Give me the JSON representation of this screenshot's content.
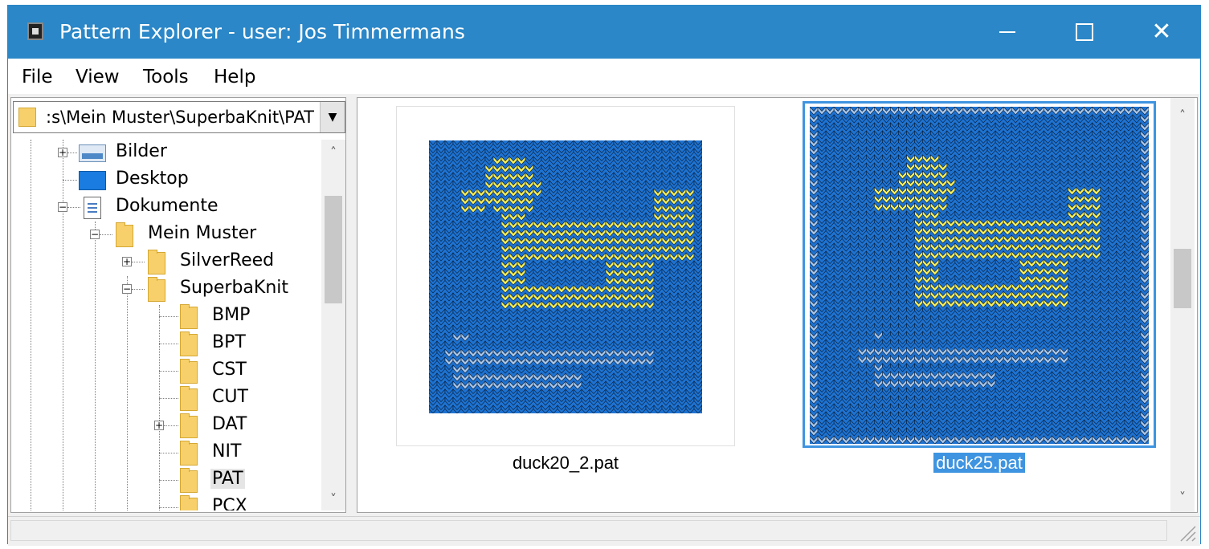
{
  "window": {
    "title": "Pattern Explorer - user: Jos Timmermans",
    "minimize_icon": "minimize-icon",
    "maximize_icon": "maximize-icon",
    "close_icon": "close-icon",
    "close_glyph": "✕"
  },
  "menu": {
    "items": [
      {
        "label": "File"
      },
      {
        "label": "View"
      },
      {
        "label": "Tools"
      },
      {
        "label": "Help"
      }
    ]
  },
  "path_combo": {
    "value": ":s\\Mein Muster\\SuperbaKnit\\PAT",
    "dropdown_glyph": "▼"
  },
  "tree": {
    "items": [
      {
        "label": "Bilder",
        "icon": "pictures-icon",
        "expander": "+"
      },
      {
        "label": "Desktop",
        "icon": "desktop-icon"
      },
      {
        "label": "Dokumente",
        "icon": "document-icon",
        "expander": "−"
      },
      {
        "label": "Mein Muster",
        "icon": "folder-icon",
        "expander": "−"
      },
      {
        "label": "SilverReed",
        "icon": "folder-icon",
        "expander": "+"
      },
      {
        "label": "SuperbaKnit",
        "icon": "folder-icon",
        "expander": "−"
      },
      {
        "label": "BMP",
        "icon": "folder-icon"
      },
      {
        "label": "BPT",
        "icon": "folder-icon"
      },
      {
        "label": "CST",
        "icon": "folder-icon"
      },
      {
        "label": "CUT",
        "icon": "folder-icon"
      },
      {
        "label": "DAT",
        "icon": "folder-icon",
        "expander": "+"
      },
      {
        "label": "NIT",
        "icon": "folder-icon"
      },
      {
        "label": "PAT",
        "icon": "folder-icon",
        "selected": true
      },
      {
        "label": "PCX",
        "icon": "folder-icon"
      }
    ],
    "scroll_up": "˄",
    "scroll_down": "˅"
  },
  "thumbnails": [
    {
      "filename": "duck20_2.pat",
      "selected": false
    },
    {
      "filename": "duck25.pat",
      "selected": true
    }
  ],
  "colors": {
    "titlebar": "#2b87c7",
    "knit_blue": "#1e73d2",
    "knit_yellow": "#f5ee5a",
    "knit_light": "#a9c6e8",
    "selection": "#3e94e0"
  }
}
